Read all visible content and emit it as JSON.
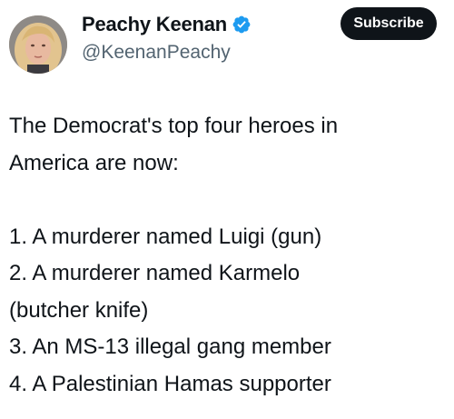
{
  "author": {
    "display_name": "Peachy Keenan",
    "handle": "@KeenanPeachy",
    "verified": true
  },
  "actions": {
    "subscribe_label": "Subscribe"
  },
  "post": {
    "lines": [
      "The Democrat's top four heroes in",
      "America are now:",
      "",
      "1. A murderer named Luigi (gun)",
      "2. A murderer named Karmelo",
      "(butcher knife)",
      "3. An MS-13 illegal gang member",
      "4. A Palestinian Hamas supporter"
    ]
  },
  "colors": {
    "text": "#0f1419",
    "secondary_text": "#536471",
    "verified_badge": "#1d9bf0",
    "subscribe_bg": "#0f1419",
    "background": "#ffffff"
  },
  "icons": {
    "verified": "verified-badge-icon"
  }
}
